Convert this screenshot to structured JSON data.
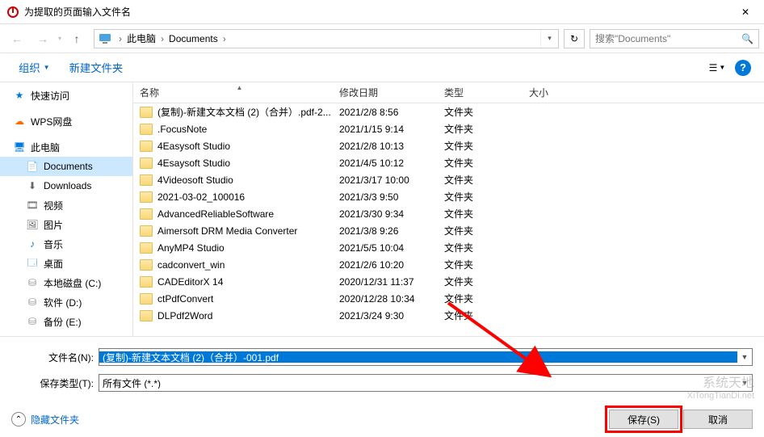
{
  "window": {
    "title": "为提取的页面输入文件名",
    "close_glyph": "✕"
  },
  "nav": {
    "back_glyph": "←",
    "fwd_glyph": "→",
    "up_glyph": "↑",
    "crumb1": "此电脑",
    "crumb2": "Documents",
    "search_placeholder": "搜索\"Documents\""
  },
  "toolbar": {
    "organize": "组织",
    "newfolder": "新建文件夹"
  },
  "sidebar": [
    {
      "label": "快速访问",
      "icon": "star",
      "color": "#0078d7"
    },
    {
      "label": "WPS网盘",
      "icon": "cloud",
      "color": "#ff6a00"
    },
    {
      "label": "此电脑",
      "icon": "pc",
      "color": "#0078d7"
    },
    {
      "label": "Documents",
      "icon": "doc",
      "color": "#666",
      "level": 2,
      "active": true
    },
    {
      "label": "Downloads",
      "icon": "down",
      "color": "#666",
      "level": 2
    },
    {
      "label": "视频",
      "icon": "video",
      "color": "#666",
      "level": 2
    },
    {
      "label": "图片",
      "icon": "pic",
      "color": "#666",
      "level": 2
    },
    {
      "label": "音乐",
      "icon": "music",
      "color": "#0078d7",
      "level": 2
    },
    {
      "label": "桌面",
      "icon": "desktop",
      "color": "#0078d7",
      "level": 2
    },
    {
      "label": "本地磁盘 (C:)",
      "icon": "drive",
      "color": "#888",
      "level": 2
    },
    {
      "label": "软件 (D:)",
      "icon": "drive",
      "color": "#888",
      "level": 2
    },
    {
      "label": "备份 (E:)",
      "icon": "drive",
      "color": "#888",
      "level": 2
    }
  ],
  "columns": {
    "name": "名称",
    "date": "修改日期",
    "type": "类型",
    "size": "大小"
  },
  "files": [
    {
      "name": "(复制)-新建文本文档 (2)（合并）.pdf-2...",
      "date": "2021/2/8 8:56",
      "type": "文件夹"
    },
    {
      "name": ".FocusNote",
      "date": "2021/1/15 9:14",
      "type": "文件夹"
    },
    {
      "name": "4Easysoft Studio",
      "date": "2021/2/8 10:13",
      "type": "文件夹"
    },
    {
      "name": "4Esaysoft Studio",
      "date": "2021/4/5 10:12",
      "type": "文件夹"
    },
    {
      "name": "4Videosoft Studio",
      "date": "2021/3/17 10:00",
      "type": "文件夹"
    },
    {
      "name": "2021-03-02_100016",
      "date": "2021/3/3 9:50",
      "type": "文件夹"
    },
    {
      "name": "AdvancedReliableSoftware",
      "date": "2021/3/30 9:34",
      "type": "文件夹"
    },
    {
      "name": "Aimersoft DRM Media Converter",
      "date": "2021/3/8 9:26",
      "type": "文件夹"
    },
    {
      "name": "AnyMP4 Studio",
      "date": "2021/5/5 10:04",
      "type": "文件夹"
    },
    {
      "name": "cadconvert_win",
      "date": "2021/2/6 10:20",
      "type": "文件夹"
    },
    {
      "name": "CADEditorX 14",
      "date": "2020/12/31 11:37",
      "type": "文件夹"
    },
    {
      "name": "ctPdfConvert",
      "date": "2020/12/28 10:34",
      "type": "文件夹"
    },
    {
      "name": "DLPdf2Word",
      "date": "2021/3/24 9:30",
      "type": "文件夹"
    }
  ],
  "form": {
    "filename_label": "文件名(N):",
    "filename_value": "(复制)-新建文本文档 (2)（合并）-001.pdf",
    "filetype_label": "保存类型(T):",
    "filetype_value": "所有文件 (*.*)"
  },
  "footer": {
    "hide_folders": "隐藏文件夹",
    "save": "保存(S)",
    "cancel": "取消"
  },
  "watermark": {
    "line1": "系统天地",
    "line2": "XiTongTianDi.net"
  }
}
